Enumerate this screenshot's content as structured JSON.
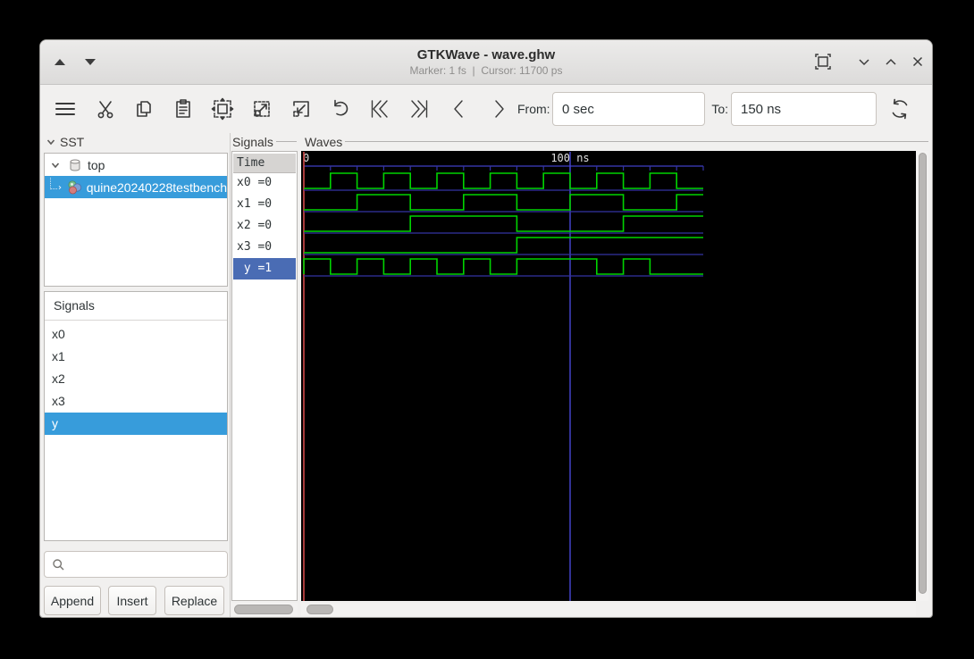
{
  "window": {
    "title": "GTKWave - wave.ghw",
    "subtitle": "Marker: 1 fs  |  Cursor: 11700 ps"
  },
  "toolbar": {
    "from_label": "From:",
    "from_value": "0 sec",
    "to_label": "To:",
    "to_value": "150 ns"
  },
  "sst": {
    "label": "SST",
    "tree": [
      {
        "label": "top"
      },
      {
        "label": "quine20240228testbench"
      }
    ]
  },
  "signal_list": {
    "header": "Signals",
    "items": [
      "x0",
      "x1",
      "x2",
      "x3",
      "y"
    ],
    "selected_index": 4,
    "search_placeholder": "",
    "buttons": {
      "append": "Append",
      "insert": "Insert",
      "replace": "Replace"
    }
  },
  "names_panel": {
    "frame_label": "Signals",
    "time_header": "Time",
    "rows": [
      "x0 =0",
      "x1 =0",
      "x2 =0",
      "x3 =0",
      " y =1"
    ],
    "selected_index": 4
  },
  "waves_panel": {
    "frame_label": "Waves"
  },
  "chart_data": {
    "type": "digital-waveform",
    "time_unit": "ns",
    "t_start": 0,
    "t_end": 150,
    "minor_tick_ns": 10,
    "timeline_labels": [
      {
        "t": 0,
        "label": "0"
      },
      {
        "t": 100,
        "label": "100 ns"
      }
    ],
    "marker_time_ns": 0,
    "cursor_gridline_ns": 100,
    "signals": [
      {
        "name": "x0",
        "value": 0,
        "initial_level": 0,
        "edges_ns": [
          10,
          20,
          30,
          40,
          50,
          60,
          70,
          80,
          90,
          100,
          110,
          120,
          130,
          140
        ]
      },
      {
        "name": "x1",
        "value": 0,
        "initial_level": 0,
        "edges_ns": [
          20,
          40,
          60,
          80,
          100,
          120,
          140
        ]
      },
      {
        "name": "x2",
        "value": 0,
        "initial_level": 0,
        "edges_ns": [
          40,
          80,
          120
        ]
      },
      {
        "name": "x3",
        "value": 0,
        "initial_level": 0,
        "edges_ns": [
          80
        ]
      },
      {
        "name": "y",
        "value": 1,
        "initial_level": 1,
        "edges_ns": [
          10,
          20,
          30,
          40,
          50,
          60,
          70,
          80,
          110,
          120,
          130
        ]
      }
    ],
    "colors": {
      "wave": "#00d400",
      "grid": "#3434a4",
      "cursor_line": "#4747d6",
      "marker_line": "#d04848",
      "timeline_text": "#e0e0e0",
      "background": "#000000"
    }
  }
}
